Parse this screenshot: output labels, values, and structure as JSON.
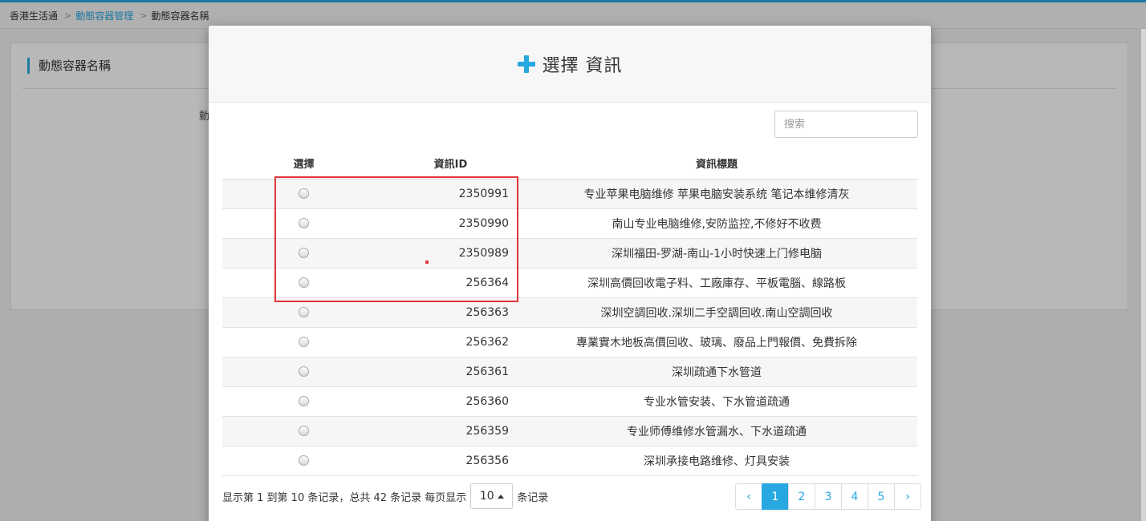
{
  "breadcrumb": {
    "items": [
      "香港生活通",
      "動態容器管理",
      "動態容器名稱"
    ]
  },
  "panel": {
    "title": "動態容器名稱",
    "fragment": "動"
  },
  "modal": {
    "title": "選擇 資訊",
    "search_placeholder": "搜索",
    "columns": [
      "選擇",
      "資訊ID",
      "資訊標題"
    ],
    "rows": [
      {
        "id": "2350991",
        "title": "专业苹果电脑维修 苹果电脑安装系统 笔记本维修清灰"
      },
      {
        "id": "2350990",
        "title": "南山专业电脑维修,安防监控,不修好不收费"
      },
      {
        "id": "2350989",
        "title": "深圳福田-罗湖-南山-1小时快速上门修电脑"
      },
      {
        "id": "256364",
        "title": "深圳高價回收電子料、工廠庫存、平板電腦、線路板"
      },
      {
        "id": "256363",
        "title": "深圳空調回收.深圳二手空調回收.南山空調回收"
      },
      {
        "id": "256362",
        "title": "專業實木地板高價回收、玻璃、廢品上門報價、免費拆除"
      },
      {
        "id": "256361",
        "title": "深圳疏通下水管道"
      },
      {
        "id": "256360",
        "title": "专业水管安装、下水管道疏通"
      },
      {
        "id": "256359",
        "title": "专业师傅维修水管漏水、下水道疏通"
      },
      {
        "id": "256356",
        "title": "深圳承接电路维修、灯具安装"
      }
    ],
    "pager": {
      "info_prefix": "显示第 1 到第 10 条记录，总共 42 条记录 每页显示",
      "page_size": "10",
      "info_suffix": "条记录",
      "prev": "‹",
      "pages": [
        "1",
        "2",
        "3",
        "4",
        "5"
      ],
      "active_page": "1",
      "next": "›"
    }
  },
  "colors": {
    "accent": "#28a8e0",
    "highlight": "#e1343b"
  }
}
